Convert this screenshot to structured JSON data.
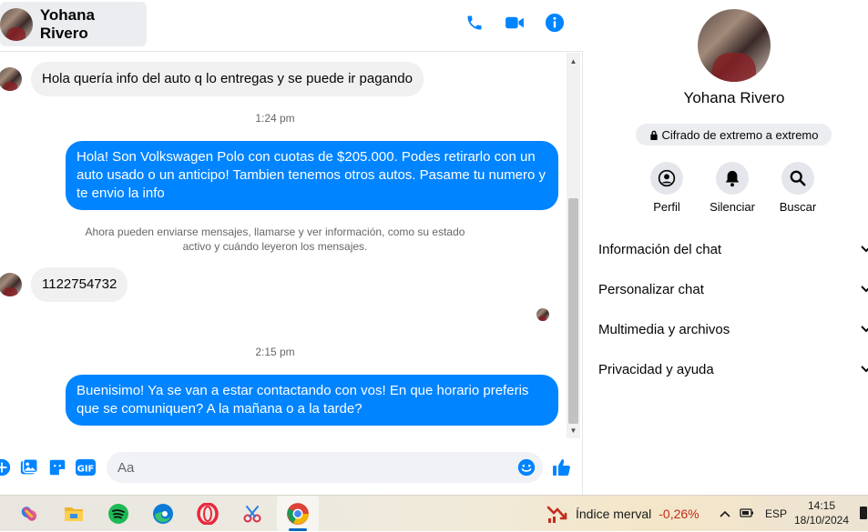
{
  "header": {
    "contact_name": "Yohana Rivero",
    "icons": [
      "phone-icon",
      "video-camera-icon",
      "info-icon"
    ],
    "accent_color": "#0084ff"
  },
  "messages": {
    "incoming_1": "Hola quería info del auto q lo entregas y se puede ir pagando",
    "time_1": "1:24 pm",
    "outgoing_1": "Hola! Son Volkswagen Polo con cuotas de $205.000. Podes retirarlo con un auto usado o un anticipo! Tambien tenemos otros autos. Pasame tu numero y te envio la info",
    "system_notice": "Ahora pueden enviarse mensajes, llamarse y ver información, como su estado activo y cuándo leyeron los mensajes.",
    "incoming_2": "1122754732",
    "time_2": "2:15 pm",
    "outgoing_2": "Buenisimo! Ya se van a estar contactando con vos! En que horario preferis que se comuniquen? A la mañana o a la tarde?"
  },
  "composer": {
    "placeholder": "Aa",
    "icons": [
      "add-circle-icon",
      "image-icon",
      "sticker-icon",
      "gif-icon",
      "emoji-icon",
      "thumbs-up-icon"
    ]
  },
  "sidebar": {
    "name": "Yohana Rivero",
    "encryption": "Cifrado de extremo a extremo",
    "actions": [
      {
        "label": "Perfil",
        "icon": "profile-icon"
      },
      {
        "label": "Silenciar",
        "icon": "bell-icon"
      },
      {
        "label": "Buscar",
        "icon": "search-icon"
      }
    ],
    "sections": [
      {
        "label": "Información del chat"
      },
      {
        "label": "Personalizar chat"
      },
      {
        "label": "Multimedia y archivos"
      },
      {
        "label": "Privacidad y ayuda"
      }
    ]
  },
  "taskbar": {
    "ticker_name": "Índice merval",
    "ticker_value": "-0,26%",
    "language": "ESP",
    "time": "14:15",
    "date": "18/10/2024"
  }
}
